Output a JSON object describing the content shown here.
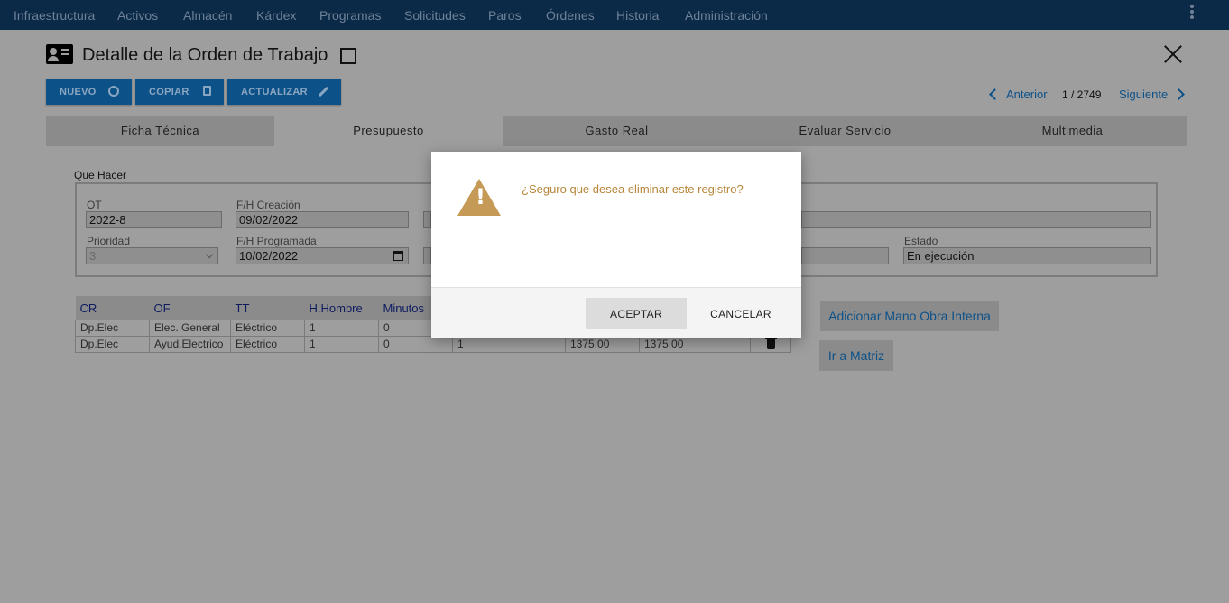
{
  "nav": {
    "items": [
      "Infraestructura",
      "Activos",
      "Almacén",
      "Kárdex",
      "Programas",
      "Solicitudes",
      "Paros",
      "Órdenes",
      "Historia",
      "Administración"
    ]
  },
  "header": {
    "title": "Detalle de la Orden de Trabajo"
  },
  "toolbar": {
    "nuevo": "NUEVO",
    "copiar": "COPIAR",
    "actualizar": "ACTUALIZAR"
  },
  "pager": {
    "prev": "Anterior",
    "count": "1 / 2749",
    "next": "Siguiente"
  },
  "tabs": [
    "Ficha Técnica",
    "Presupuesto",
    "Gasto Real",
    "Evaluar Servicio",
    "Multimedia"
  ],
  "form": {
    "legend": "Que Hacer",
    "ot_label": "OT",
    "ot_value": "2022-8",
    "fh_creacion_label": "F/H Creación",
    "fh_creacion_value": "09/02/2022",
    "prioridad_label": "Prioridad",
    "prioridad_value": "3",
    "fh_programada_label": "F/H Programada",
    "fh_programada_value": "10/02/2022",
    "estado_label": "Estado",
    "estado_value": "En ejecución"
  },
  "table": {
    "headers": [
      "CR",
      "OF",
      "TT",
      "H.Hombre",
      "Minutos"
    ],
    "rows": [
      {
        "cr": "Dp.Elec",
        "of": "Elec. General",
        "tt": "Eléctrico",
        "hh": "1",
        "min": "0",
        "c6": "",
        "c7": "",
        "c8": ""
      },
      {
        "cr": "Dp.Elec",
        "of": "Ayud.Electrico",
        "tt": "Eléctrico",
        "hh": "1",
        "min": "0",
        "c6": "1",
        "c7": "1375.00",
        "c8": "1375.00"
      }
    ]
  },
  "side": {
    "add_internal": "Adicionar Mano Obra Interna",
    "matrix": "Ir a Matriz"
  },
  "modal": {
    "message": "¿Seguro que desea eliminar este registro?",
    "accept": "ACEPTAR",
    "cancel": "CANCELAR"
  }
}
